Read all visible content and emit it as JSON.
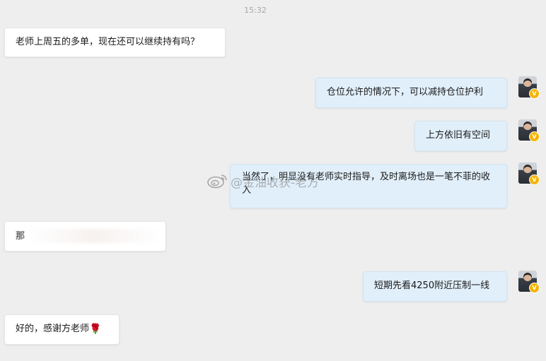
{
  "timestamp": "15:32",
  "messages": [
    {
      "side": "in",
      "text": "老师上周五的多单，现在还可以继续持有吗？"
    },
    {
      "side": "out",
      "text": "仓位允许的情况下，可以减持仓位护利"
    },
    {
      "side": "out",
      "text": "上方依旧有空间"
    },
    {
      "side": "out",
      "text": "当然了，明显没有老师实时指导，及时离场也是一笔不菲的收入"
    },
    {
      "side": "in",
      "text": "那"
    },
    {
      "side": "out",
      "text": "短期先看4250附近压制一线"
    },
    {
      "side": "in",
      "text": "好的，感谢方老师",
      "emoji": "🌹"
    }
  ],
  "watermark": "@金油收获-老方",
  "colors": {
    "background": "#eeeeee",
    "incoming": "#ffffff",
    "outgoing": "#e1effa",
    "badge": "#f5b400"
  }
}
